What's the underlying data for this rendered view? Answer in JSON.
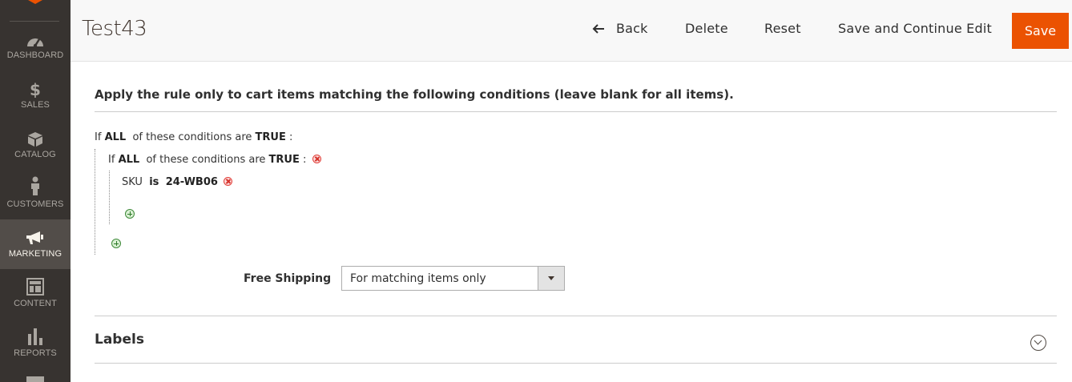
{
  "sidebar": {
    "items": [
      {
        "label": "DASHBOARD",
        "icon": "dashboard-icon"
      },
      {
        "label": "SALES",
        "icon": "dollar-icon"
      },
      {
        "label": "CATALOG",
        "icon": "box-icon"
      },
      {
        "label": "CUSTOMERS",
        "icon": "person-icon"
      },
      {
        "label": "MARKETING",
        "icon": "megaphone-icon",
        "active": true
      },
      {
        "label": "CONTENT",
        "icon": "layout-icon"
      },
      {
        "label": "REPORTS",
        "icon": "bar-chart-icon"
      }
    ]
  },
  "header": {
    "title": "Test43",
    "back_label": "Back",
    "delete_label": "Delete",
    "reset_label": "Reset",
    "save_continue_label": "Save and Continue Edit",
    "save_label": "Save"
  },
  "conditions": {
    "section_title": "Apply the rule only to cart items matching the following conditions (leave blank for all items).",
    "outer": {
      "prefix": "If",
      "aggregator": "ALL",
      "middle": "of these conditions are",
      "value": "TRUE",
      "suffix": ":"
    },
    "inner": {
      "prefix": "If",
      "aggregator": "ALL",
      "middle": "of these conditions are",
      "value": "TRUE",
      "suffix": ":"
    },
    "rule": {
      "attribute": "SKU",
      "operator": "is",
      "value": "24-WB06"
    }
  },
  "free_shipping": {
    "label": "Free Shipping",
    "selected": "For matching items only"
  },
  "labels_section": {
    "title": "Labels"
  },
  "colors": {
    "accent": "#eb5202",
    "sidebar_bg": "#373330",
    "sidebar_active": "#524d49"
  }
}
